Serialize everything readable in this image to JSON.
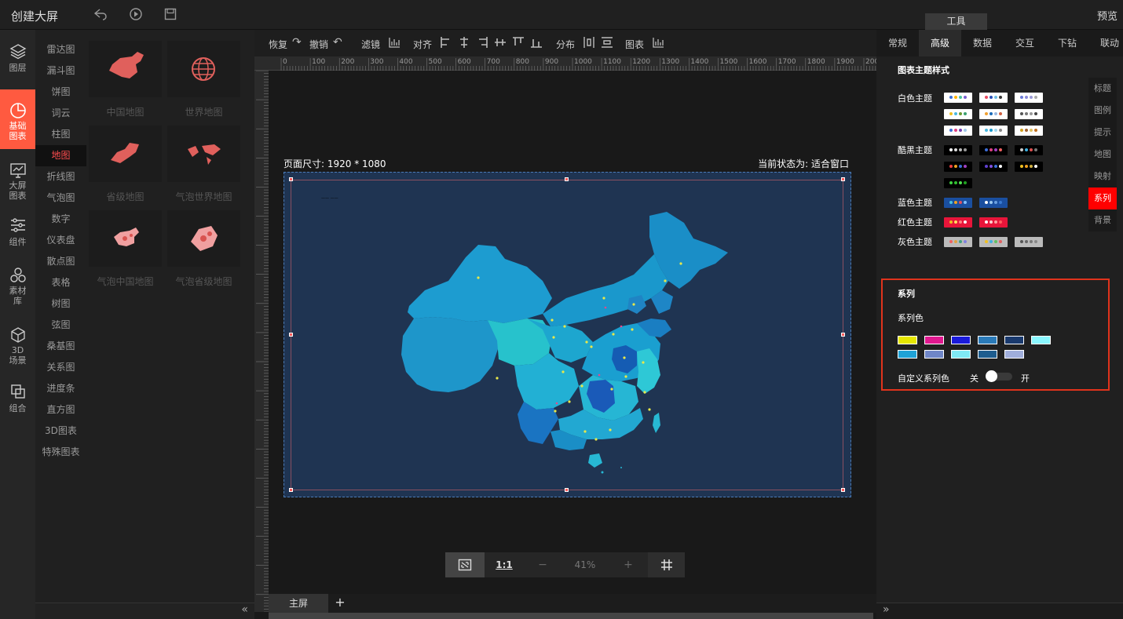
{
  "header": {
    "title": "创建大屏",
    "preview": "预览",
    "tools_tab": "工具"
  },
  "icon_nav": [
    {
      "label": "图层",
      "icon": "layers-icon"
    },
    {
      "label": "基础\n图表",
      "icon": "pie-chart-icon",
      "active": true
    },
    {
      "label": "大屏\n图表",
      "icon": "monitor-chart-icon"
    },
    {
      "label": "组件",
      "icon": "sliders-icon"
    },
    {
      "label": "素材\n库",
      "icon": "hexagons-icon"
    },
    {
      "label": "3D\n场景",
      "icon": "cube-icon"
    },
    {
      "label": "组合",
      "icon": "group-icon"
    }
  ],
  "categories": [
    "雷达图",
    "漏斗图",
    "饼图",
    "词云",
    "柱图",
    "地图",
    "折线图",
    "气泡图",
    "数字",
    "仪表盘",
    "散点图",
    "表格",
    "树图",
    "弦图",
    "桑基图",
    "关系图",
    "进度条",
    "直方图",
    "3D图表",
    "特殊图表"
  ],
  "active_category": "地图",
  "thumbnails": [
    "中国地图",
    "世界地图",
    "省级地图",
    "气泡世界地图",
    "气泡中国地图",
    "气泡省级地图"
  ],
  "toolbar": {
    "redo": "恢复",
    "undo": "撤销",
    "filter": "滤镜",
    "align": "对齐",
    "distribute": "分布",
    "chart": "图表"
  },
  "ruler": {
    "marks": [
      "0",
      "100",
      "200",
      "300",
      "400",
      "500",
      "600",
      "700",
      "800",
      "900",
      "1000",
      "1100",
      "1200",
      "1300",
      "1400",
      "1500",
      "1600",
      "1700",
      "1800",
      "1900",
      "200"
    ]
  },
  "canvas": {
    "size_label": "页面尺寸: 1920 * 1080",
    "state_label": "当前状态为: 适合窗口"
  },
  "zoom": {
    "one_to_one": "1:1",
    "minus": "−",
    "value": "41%",
    "plus": "+"
  },
  "pages": {
    "main_tab": "主屏",
    "add": "+"
  },
  "right_tabs": [
    "常规",
    "高级",
    "数据",
    "交互",
    "下钻",
    "联动"
  ],
  "right_active_tab": "高级",
  "theme_section": {
    "title": "图表主题样式",
    "white": "白色主题",
    "black": "酷黑主题",
    "blue": "蓝色主题",
    "red": "红色主题",
    "gray": "灰色主题"
  },
  "side_tabs": [
    "标题",
    "图例",
    "提示",
    "地图",
    "映射",
    "系列",
    "背景"
  ],
  "side_active": "系列",
  "series": {
    "title": "系列",
    "color_label": "系列色",
    "colors": [
      "#e6e600",
      "#e0188f",
      "#1a1adb",
      "#2a7ab8",
      "#1a3a6e",
      "#8af7ff",
      "#1fa2d6",
      "#6f86c8",
      "#7fe9f5",
      "#1e5d8f",
      "#a0aedb"
    ],
    "custom_label": "自定义系列色",
    "off": "关",
    "on": "开"
  }
}
